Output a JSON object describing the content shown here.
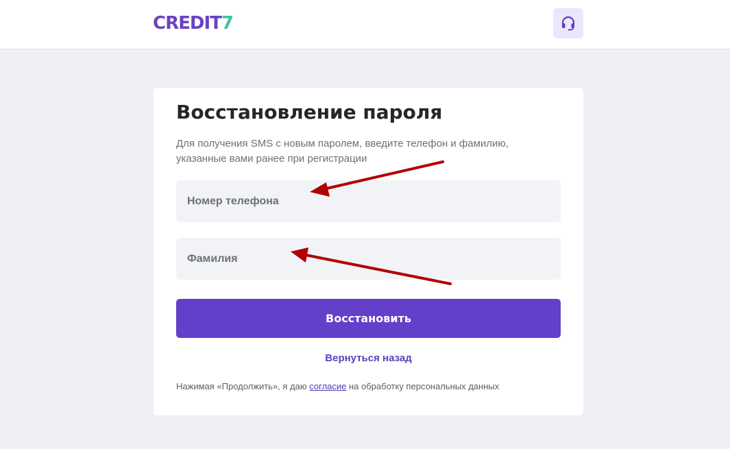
{
  "header": {
    "logo_main": "CREDIT",
    "logo_accent": "7",
    "support_icon": "headset-icon"
  },
  "form": {
    "title": "Восстановление пароля",
    "subtitle": "Для получения SMS с новым паролем, введите телефон и фамилию, указанные вами ранее при регистрации",
    "phone_placeholder": "Номер телефона",
    "phone_value": "",
    "surname_placeholder": "Фамилия",
    "surname_value": "",
    "submit_label": "Восстановить",
    "back_label": "Вернуться назад",
    "consent_prefix": "Нажимая «Продолжить», я даю ",
    "consent_link": "согласие",
    "consent_suffix": " на обработку персональных данных"
  },
  "colors": {
    "accent": "#643fca",
    "logo_green": "#41c2a0",
    "annotation_arrow": "#b00000"
  }
}
